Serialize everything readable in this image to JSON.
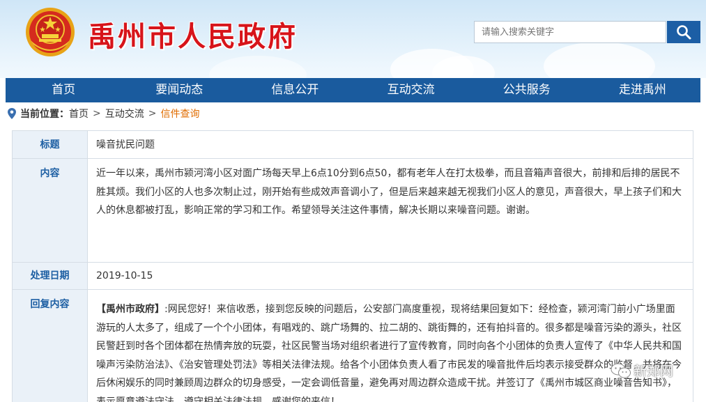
{
  "header": {
    "site_title": "禹州市人民政府",
    "search_placeholder": "请输入搜索关键字"
  },
  "nav": {
    "items": [
      "首页",
      "要闻动态",
      "信息公开",
      "互动交流",
      "公共服务",
      "走进禹州"
    ]
  },
  "breadcrumb": {
    "label": "当前位置：",
    "items": [
      "首页",
      "互动交流"
    ],
    "current": "信件查询",
    "separator": ">"
  },
  "letter": {
    "title_label": "标题",
    "title": "噪音扰民问题",
    "content_label": "内容",
    "content": "近一年以来，禹州市颍河湾小区对面广场每天早上6点10分到6点50，都有老年人在打太极拳，而且音箱声音很大，前排和后排的居民不胜其烦。我们小区的人也多次制止过，刚开始有些成效声音调小了，但是后来越来越无视我们小区人的意见，声音很大，早上孩子们和大人的休息都被打乱，影响正常的学习和工作。希望领导关注这件事情，解决长期以来噪音问题。谢谢。",
    "date_label": "处理日期",
    "date": "2019-10-15",
    "reply_label": "回复内容",
    "reply_org": "【禹州市政府】",
    "reply_text": ":网民您好！来信收悉，接到您反映的问题后，公安部门高度重视，现将结果回复如下：经检查，颍河湾门前小广场里面游玩的人太多了，组成了一个个小团体，有唱戏的、跳广场舞的、拉二胡的、跳街舞的，还有拍抖音的。很多都是噪音污染的源头，社区民警赶到时各个团体都在热情奔放的玩耍，社区民警当场对组织者进行了宣传教育，同时向各个小团体的负责人宣传了《中华人民共和国噪声污染防治法》、《治安管理处罚法》等相关法律法规。给各个小团体负责人看了市民发的噪音批件后均表示接受群众的监督，并将在今后休闲娱乐的同时兼顾周边群众的切身感受，一定会调低音量，避免再对周边群众造成干扰。并签订了《禹州市城区商业噪音告知书》，表示愿意遵法守法，遵守相关法律法规。感谢您的来信！"
  },
  "watermark": {
    "text": "新郑网"
  },
  "colors": {
    "nav_bg": "#1a5b9e",
    "title_red": "#d7141a",
    "key_text": "#1d5fa3",
    "current_orange": "#e06c00"
  }
}
